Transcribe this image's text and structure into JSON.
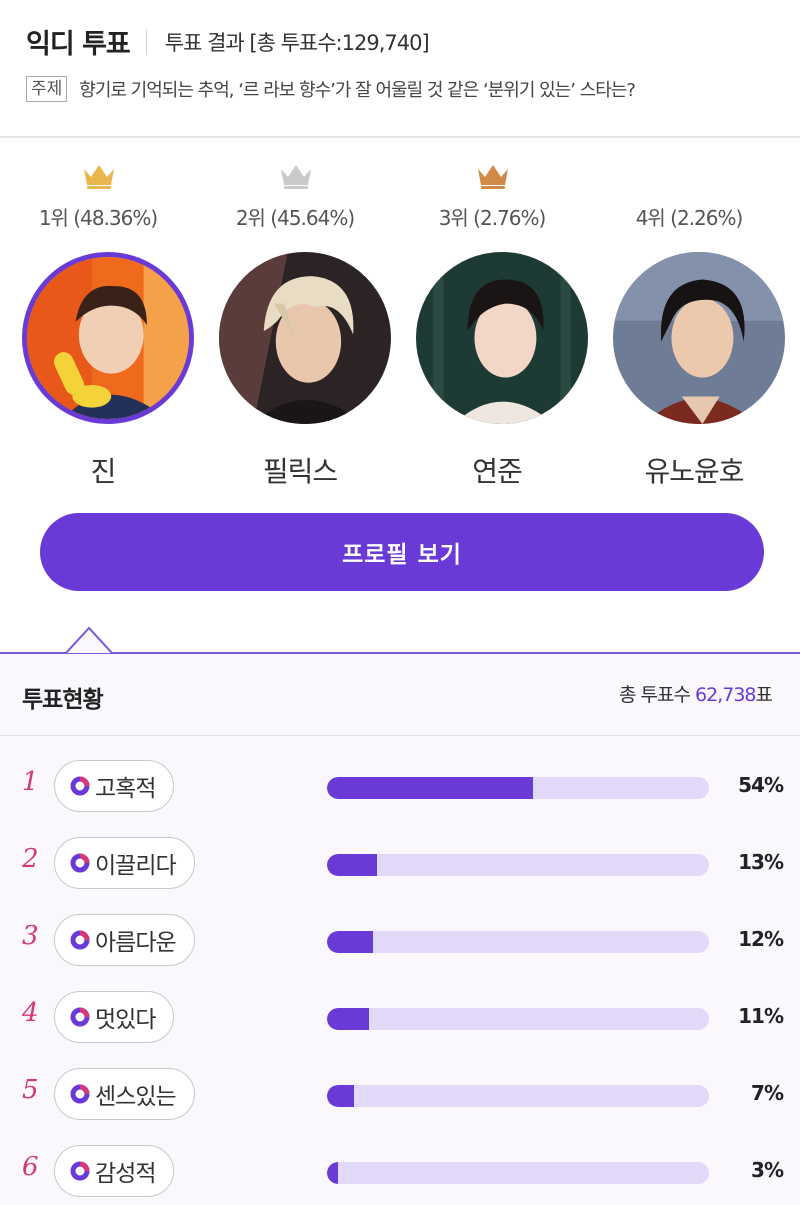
{
  "header": {
    "brand": "익디 투표",
    "result_text": "투표 결과 [총 투표수:129,740]",
    "topic_badge": "주제",
    "topic_text": "향기로 기억되는 추억, ‘르 라보 향수’가 잘 어울릴 것 같은 ‘분위기 있는’ 스타는?"
  },
  "rankings": [
    {
      "rank_text": "1위 (48.36%)",
      "name": "진",
      "crown_color": "#e8b64c",
      "selected": true
    },
    {
      "rank_text": "2위 (45.64%)",
      "name": "필릭스",
      "crown_color": "#c9c9c9",
      "selected": false
    },
    {
      "rank_text": "3위 (2.76%)",
      "name": "연준",
      "crown_color": "#d08a45",
      "selected": false
    },
    {
      "rank_text": "4위 (2.26%)",
      "name": "유노윤호",
      "crown_color": null,
      "selected": false
    }
  ],
  "profile_button": "프로필 보기",
  "vote_status": {
    "title": "투표현황",
    "total_label": "총 투표수",
    "total_value": "62,738",
    "total_unit": "표",
    "rows": [
      {
        "num": "1",
        "label": "고혹적",
        "pct_text": "54%",
        "fraction": 0.54
      },
      {
        "num": "2",
        "label": "이끌리다",
        "pct_text": "13%",
        "fraction": 0.13
      },
      {
        "num": "3",
        "label": "아름다운",
        "pct_text": "12%",
        "fraction": 0.12
      },
      {
        "num": "4",
        "label": "멋있다",
        "pct_text": "11%",
        "fraction": 0.11
      },
      {
        "num": "5",
        "label": "센스있는",
        "pct_text": "7%",
        "fraction": 0.07
      },
      {
        "num": "6",
        "label": "감성적",
        "pct_text": "3%",
        "fraction": 0.03
      }
    ]
  },
  "colors": {
    "accent": "#6a3ad6",
    "bar_track": "#e2d8f7",
    "row_number": "#d4387a"
  }
}
